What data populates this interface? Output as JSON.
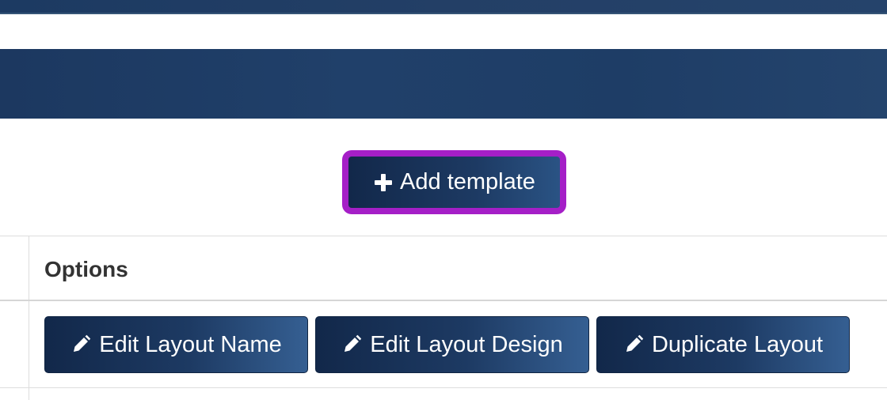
{
  "toolbar": {
    "add_template_label": "Add template",
    "add_icon": "plus-icon"
  },
  "table": {
    "header": {
      "options_label": "Options"
    },
    "row": {
      "actions": [
        {
          "label": "Edit Layout Name",
          "icon": "pencil-icon"
        },
        {
          "label": "Edit Layout Design",
          "icon": "pencil-icon"
        },
        {
          "label": "Duplicate Layout",
          "icon": "pencil-icon"
        }
      ]
    }
  },
  "colors": {
    "brand_navy": "#1d3a63",
    "highlight": "#a51fc7"
  }
}
